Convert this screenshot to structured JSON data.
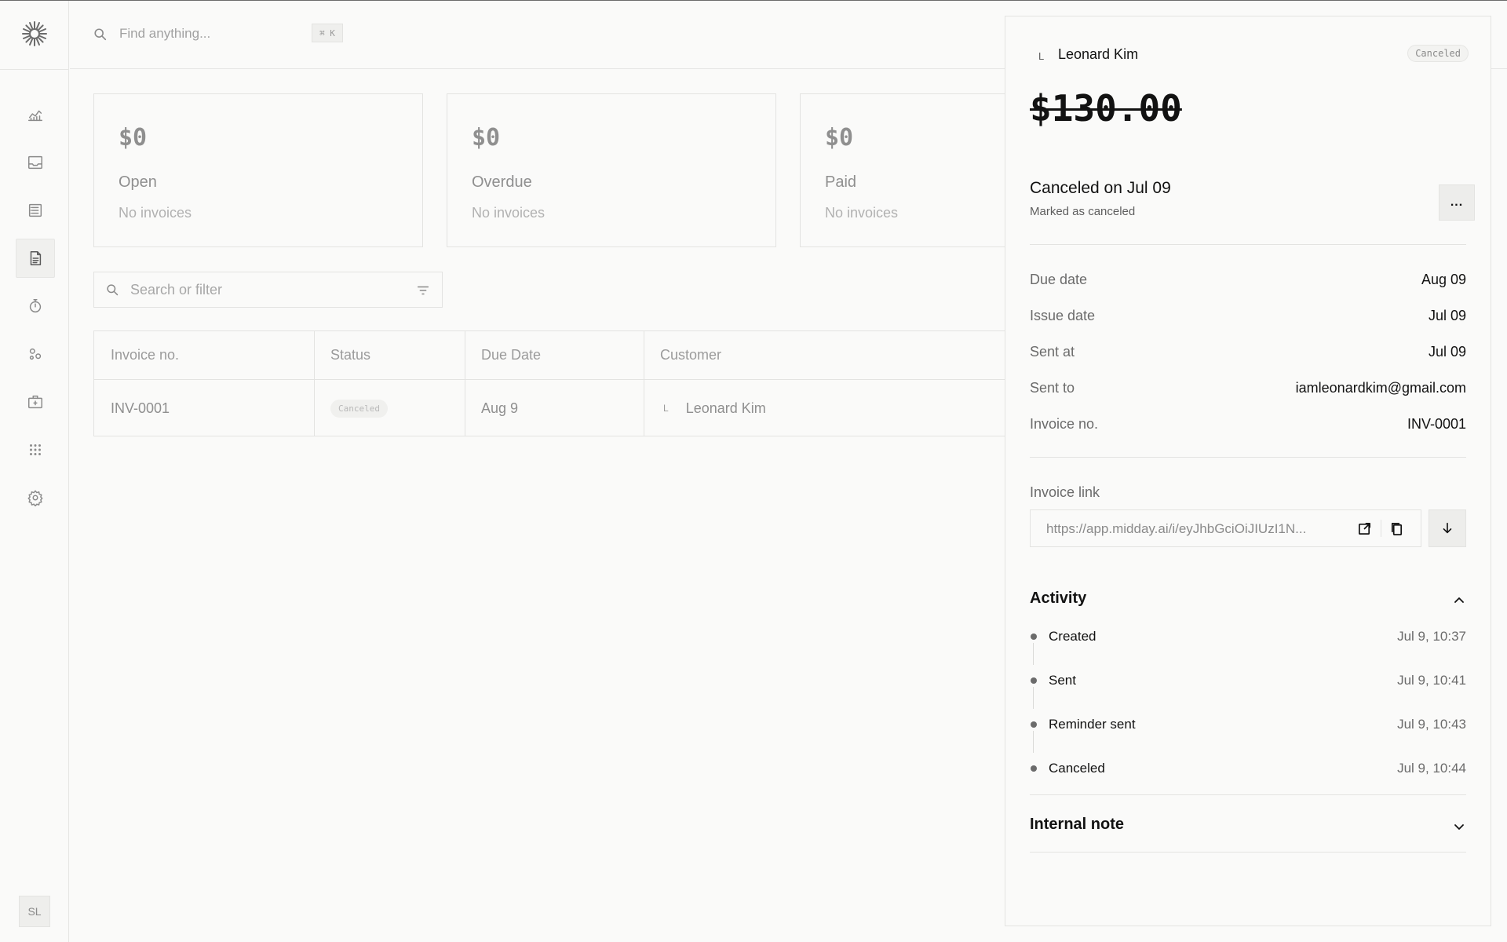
{
  "search": {
    "placeholder": "Find anything...",
    "shortcut": "⌘ K"
  },
  "sidebar": {
    "items": [
      {
        "icon": "chart-icon"
      },
      {
        "icon": "inbox-icon"
      },
      {
        "icon": "transactions-icon"
      },
      {
        "icon": "invoice-icon",
        "active": true
      },
      {
        "icon": "timer-icon"
      },
      {
        "icon": "customers-icon"
      },
      {
        "icon": "vault-icon"
      },
      {
        "icon": "apps-icon"
      },
      {
        "icon": "settings-icon"
      }
    ],
    "user_initials": "SL"
  },
  "summary": [
    {
      "amount": "$0",
      "label": "Open",
      "sub": "No invoices"
    },
    {
      "amount": "$0",
      "label": "Overdue",
      "sub": "No invoices"
    },
    {
      "amount": "$0",
      "label": "Paid",
      "sub": "No invoices"
    }
  ],
  "filter": {
    "placeholder": "Search or filter"
  },
  "table": {
    "headers": {
      "invoice_no": "Invoice no.",
      "status": "Status",
      "due_date": "Due Date",
      "customer": "Customer"
    },
    "rows": [
      {
        "invoice_no": "INV-0001",
        "status": "Canceled",
        "due_date": "Aug 9",
        "customer_initial": "L",
        "customer": "Leonard Kim"
      }
    ]
  },
  "detail": {
    "customer_initial": "L",
    "customer_name": "Leonard Kim",
    "badge": "Canceled",
    "amount": "$130.00",
    "status_title": "Canceled on Jul 09",
    "status_sub": "Marked as canceled",
    "more_label": "...",
    "fields": [
      {
        "label": "Due date",
        "value": "Aug 09"
      },
      {
        "label": "Issue date",
        "value": "Jul 09"
      },
      {
        "label": "Sent at",
        "value": "Jul 09"
      },
      {
        "label": "Sent to",
        "value": "iamleonardkim@gmail.com"
      },
      {
        "label": "Invoice no.",
        "value": "INV-0001"
      }
    ],
    "link_label": "Invoice link",
    "link_url": "https://app.midday.ai/i/eyJhbGciOiJIUzI1N...",
    "activity_title": "Activity",
    "activity": [
      {
        "label": "Created",
        "time": "Jul 9, 10:37"
      },
      {
        "label": "Sent",
        "time": "Jul 9, 10:41"
      },
      {
        "label": "Reminder sent",
        "time": "Jul 9, 10:43"
      },
      {
        "label": "Canceled",
        "time": "Jul 9, 10:44"
      }
    ],
    "internal_note_title": "Internal note"
  }
}
